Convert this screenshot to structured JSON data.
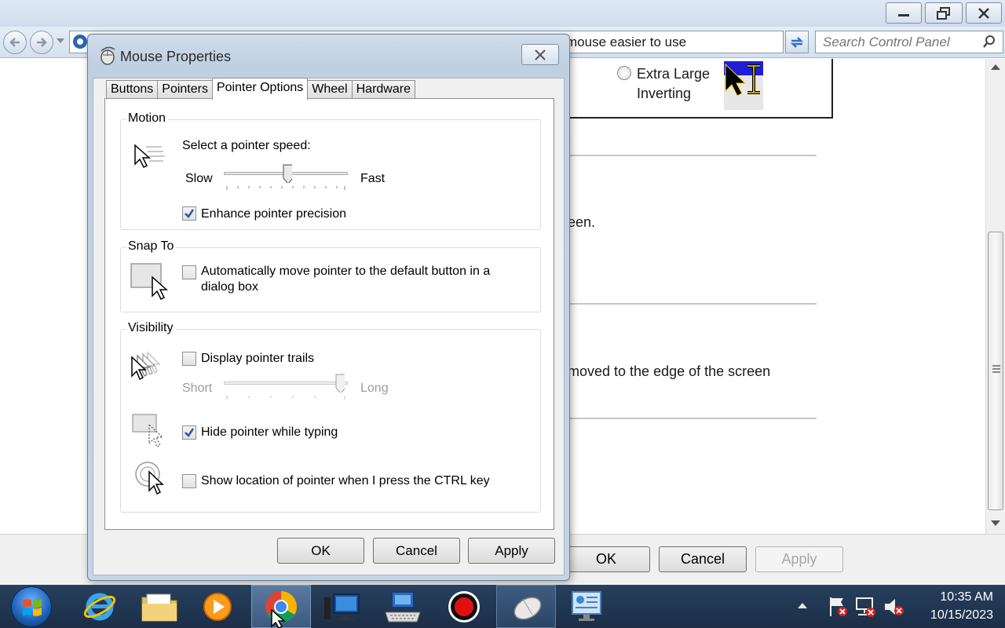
{
  "background_window": {
    "address_text": "mouse easier to use",
    "search_placeholder": "Search Control Panel",
    "pointer_scheme_option": "Extra Large\nInverting",
    "text_line_1": "een.",
    "text_line_2": "moved to the edge of the screen",
    "ok_label": "OK",
    "cancel_label": "Cancel",
    "apply_label": "Apply"
  },
  "dialog": {
    "title": "Mouse Properties",
    "tabs": [
      {
        "label": "Buttons",
        "active": false
      },
      {
        "label": "Pointers",
        "active": false
      },
      {
        "label": "Pointer Options",
        "active": true
      },
      {
        "label": "Wheel",
        "active": false
      },
      {
        "label": "Hardware",
        "active": false
      }
    ],
    "motion": {
      "group_label": "Motion",
      "speed_label": "Select a pointer speed:",
      "slow_label": "Slow",
      "fast_label": "Fast",
      "speed_value": 0.5,
      "precision_label": "Enhance pointer precision",
      "precision_checked": true
    },
    "snap_to": {
      "group_label": "Snap To",
      "auto_label": "Automatically move pointer to the default button in a\ndialog box",
      "auto_checked": false
    },
    "visibility": {
      "group_label": "Visibility",
      "trails_label": "Display pointer trails",
      "trails_checked": false,
      "short_label": "Short",
      "long_label": "Long",
      "trails_value": 1.0,
      "hide_label": "Hide pointer while typing",
      "hide_checked": true,
      "ctrl_label": "Show location of pointer when I press the CTRL key",
      "ctrl_checked": false
    },
    "ok_label": "OK",
    "cancel_label": "Cancel",
    "apply_label": "Apply"
  },
  "taskbar": {
    "items": [
      "start",
      "internet-explorer",
      "file-explorer",
      "media-player",
      "chrome",
      "remote-desktop",
      "on-screen-keyboard",
      "screen-recorder",
      "mouse",
      "control-panel"
    ],
    "active_item": "chrome",
    "time": "10:35 AM",
    "date": "10/15/2023"
  },
  "colors": {
    "accent": "#3c7bd3",
    "taskbar": "#1f3450",
    "dialog_frame": "#c5d4e5"
  }
}
